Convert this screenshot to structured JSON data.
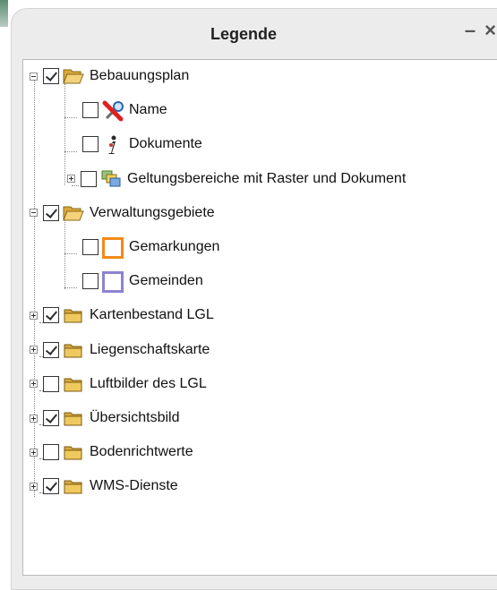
{
  "window": {
    "title": "Legende",
    "minimize_glyph": "–",
    "close_glyph": "×"
  },
  "tree": [
    {
      "id": "bebauungsplan",
      "label": "Bebauungsplan",
      "level": 0,
      "expander": "minus",
      "checked": true,
      "icon": "folder-open-icon"
    },
    {
      "id": "name",
      "label": "Name",
      "level": 1,
      "expander": null,
      "checked": false,
      "icon": "pin-search-icon"
    },
    {
      "id": "dokumente",
      "label": "Dokumente",
      "level": 1,
      "expander": null,
      "checked": false,
      "icon": "info-icon"
    },
    {
      "id": "geltungsbereiche",
      "label": "Geltungsbereiche mit Raster und Dokument",
      "level": 1,
      "expander": "plus",
      "checked": false,
      "icon": "layers-icon"
    },
    {
      "id": "verwaltungsgebiete",
      "label": "Verwaltungsgebiete",
      "level": 0,
      "expander": "minus",
      "checked": true,
      "icon": "folder-open-icon"
    },
    {
      "id": "gemarkungen",
      "label": "Gemarkungen",
      "level": 1,
      "expander": null,
      "checked": false,
      "icon": "orange-square-icon"
    },
    {
      "id": "gemeinden",
      "label": "Gemeinden",
      "level": 1,
      "expander": null,
      "checked": false,
      "icon": "purple-square-icon"
    },
    {
      "id": "kartenbestand",
      "label": "Kartenbestand LGL",
      "level": 0,
      "expander": "plus",
      "checked": true,
      "icon": "folder-icon"
    },
    {
      "id": "liegenschaftskarte",
      "label": "Liegenschaftskarte",
      "level": 0,
      "expander": "plus",
      "checked": true,
      "icon": "folder-icon"
    },
    {
      "id": "luftbilder",
      "label": "Luftbilder des LGL",
      "level": 0,
      "expander": "plus",
      "checked": false,
      "icon": "folder-icon"
    },
    {
      "id": "uebersichtsbild",
      "label": "Übersichtsbild",
      "level": 0,
      "expander": "plus",
      "checked": true,
      "icon": "folder-icon"
    },
    {
      "id": "bodenrichtwerte",
      "label": "Bodenrichtwerte",
      "level": 0,
      "expander": "plus",
      "checked": false,
      "icon": "folder-icon"
    },
    {
      "id": "wms-dienste",
      "label": "WMS-Dienste",
      "level": 0,
      "expander": "plus",
      "checked": true,
      "icon": "folder-icon"
    }
  ],
  "colors": {
    "panel_bg": "#ececec",
    "tree_bg": "#ffffff",
    "folder_fill": "#e8c25a",
    "gemarkungen_border": "#f08a1a",
    "gemeinden_border": "#8a84d0"
  }
}
